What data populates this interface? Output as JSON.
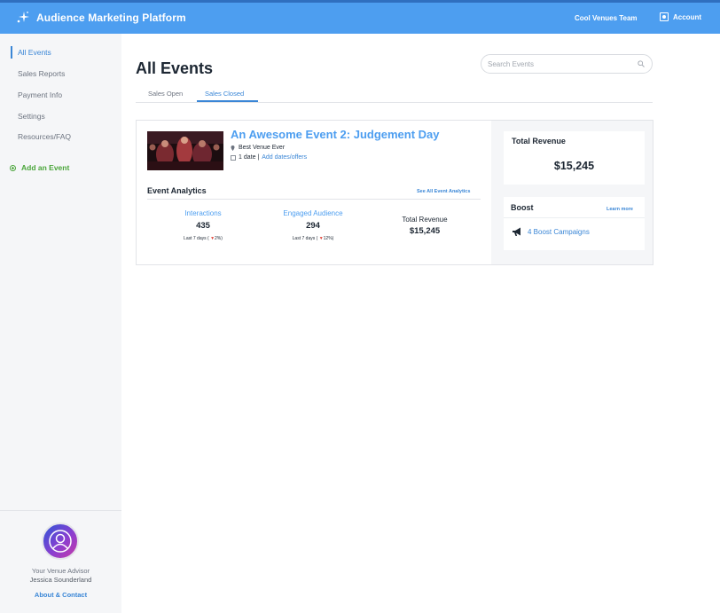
{
  "header": {
    "app_title": "Audience Marketing Platform",
    "team": "Cool Venues Team",
    "account": "Account"
  },
  "sidebar": {
    "items": [
      {
        "label": "All Events",
        "active": true
      },
      {
        "label": "Sales Reports"
      },
      {
        "label": "Payment Info"
      },
      {
        "label": "Settings"
      },
      {
        "label": "Resources/FAQ"
      }
    ],
    "add_event": "Add an Event",
    "advisor_label": "Your Venue Advisor",
    "advisor_name": "Jessica Sounderland",
    "about": "About & Contact"
  },
  "main": {
    "title": "All Events",
    "search_placeholder": "Search Events",
    "tabs": [
      {
        "label": "Sales Open"
      },
      {
        "label": "Sales Closed",
        "active": true
      }
    ]
  },
  "event": {
    "title": "An Awesome Event 2: Judgement Day",
    "venue": "Best Venue Ever",
    "dates_count": "1 date |",
    "dates_link": "Add dates/offers",
    "analytics": {
      "title": "Event Analytics",
      "link": "See All Event Analytics",
      "interactions": {
        "label": "Interactions",
        "value": "435",
        "period": "Last 7 days (",
        "change": "2%",
        "close": ")"
      },
      "engaged": {
        "label": "Engaged Audience",
        "value": "294",
        "period": "Last 7 days (",
        "change": "12%",
        "close": ")"
      },
      "revenue": {
        "label": "Total Revenue",
        "value": "$15,245"
      }
    },
    "total_revenue": {
      "title": "Total Revenue",
      "value": "$15,245"
    },
    "boost": {
      "title": "Boost",
      "learn_more": "Learn more",
      "campaigns": "4 Boost Campaigns"
    }
  },
  "colors": {
    "header": "#4d9ef0",
    "accent": "#3a86d6",
    "add_event": "#4aa53a",
    "down": "#e0483e"
  }
}
